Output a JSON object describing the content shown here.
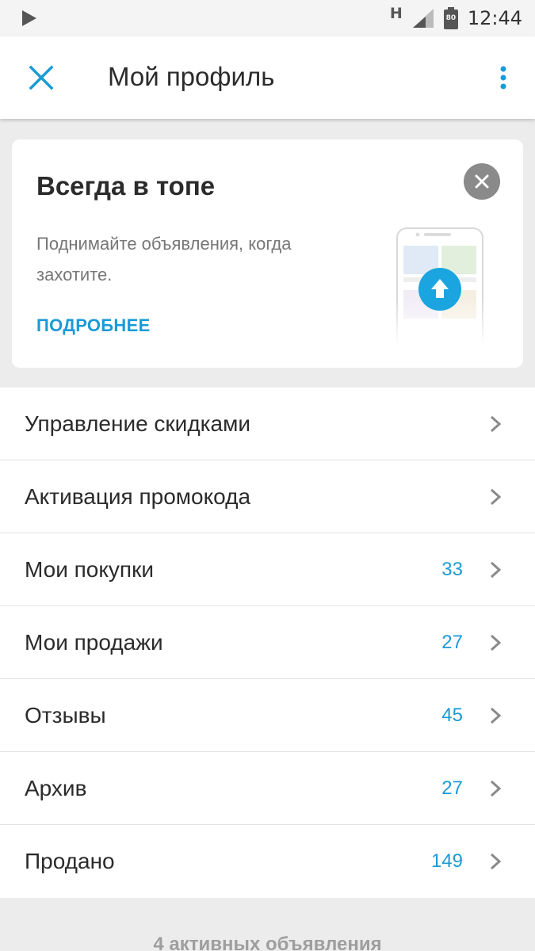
{
  "status_bar": {
    "network": "H",
    "battery": "80",
    "time": "12:44"
  },
  "app_bar": {
    "title": "Мой профиль"
  },
  "promo": {
    "title": "Всегда в топе",
    "description": "Поднимайте объявления, когда захотите.",
    "link": "ПОДРОБНЕЕ"
  },
  "menu": {
    "items": [
      {
        "label": "Управление скидками",
        "count": ""
      },
      {
        "label": "Активация промокода",
        "count": ""
      },
      {
        "label": "Мои покупки",
        "count": "33"
      },
      {
        "label": "Мои продажи",
        "count": "27"
      },
      {
        "label": "Отзывы",
        "count": "45"
      },
      {
        "label": "Архив",
        "count": "27"
      },
      {
        "label": "Продано",
        "count": "149"
      }
    ]
  },
  "footer": {
    "text": "4 активных объявления"
  },
  "colors": {
    "accent": "#1a9bd7",
    "background": "#ececec",
    "card": "#ffffff"
  }
}
